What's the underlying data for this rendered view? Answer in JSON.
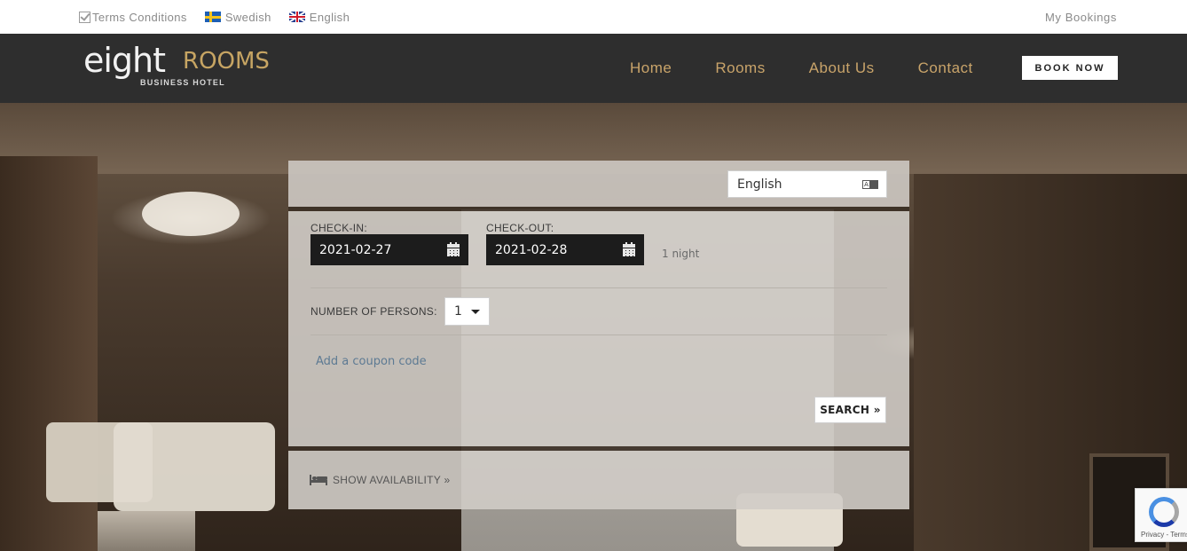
{
  "topbar": {
    "terms_label": "Terms Conditions",
    "languages": [
      "Swedish",
      "English"
    ],
    "my_bookings_label": "My Bookings"
  },
  "header": {
    "logo": {
      "eight": "eight",
      "rooms": "ROOMS",
      "sub": "BUSINESS HOTEL"
    },
    "nav": [
      "Home",
      "Rooms",
      "About Us",
      "Contact"
    ],
    "book_now_label": "BOOK NOW"
  },
  "booking": {
    "language_value": "English",
    "checkin_label": "CHECK-IN:",
    "checkin_value": "2021-02-27",
    "checkout_label": "CHECK-OUT:",
    "checkout_value": "2021-02-28",
    "nights": "1 night",
    "persons_label": "NUMBER OF PERSONS:",
    "persons_value": "1",
    "coupon_label": "Add a coupon code",
    "search_label": "SEARCH »",
    "availability_label": "SHOW AVAILABILITY »"
  },
  "recaptcha": {
    "text": "Privacy - Terms"
  },
  "colors": {
    "nav": "#c9a46a",
    "header_bg": "#2e2e2e",
    "accent_gold": "#c7a563"
  }
}
